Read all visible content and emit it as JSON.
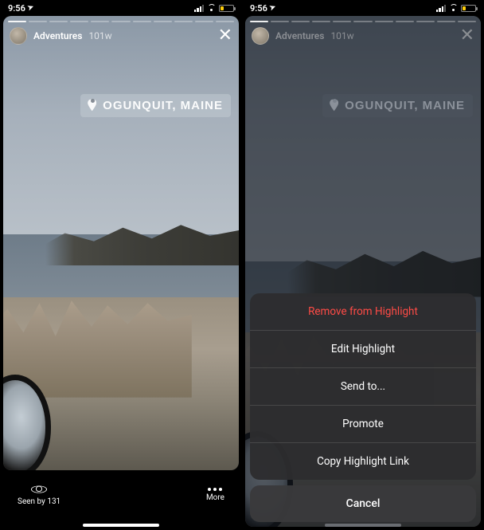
{
  "status": {
    "time": "9:56",
    "loc_arrow": "➤"
  },
  "story": {
    "highlight_name": "Adventures",
    "age": "101w",
    "geo_label": "OGUNQUIT, MAINE"
  },
  "bottom": {
    "seen_by_label": "Seen by 131",
    "more_label": "More"
  },
  "sheet": {
    "items": [
      {
        "label": "Remove from Highlight",
        "destructive": true
      },
      {
        "label": "Edit Highlight",
        "destructive": false
      },
      {
        "label": "Send to...",
        "destructive": false
      },
      {
        "label": "Promote",
        "destructive": false
      },
      {
        "label": "Copy Highlight Link",
        "destructive": false
      }
    ],
    "cancel_label": "Cancel"
  }
}
